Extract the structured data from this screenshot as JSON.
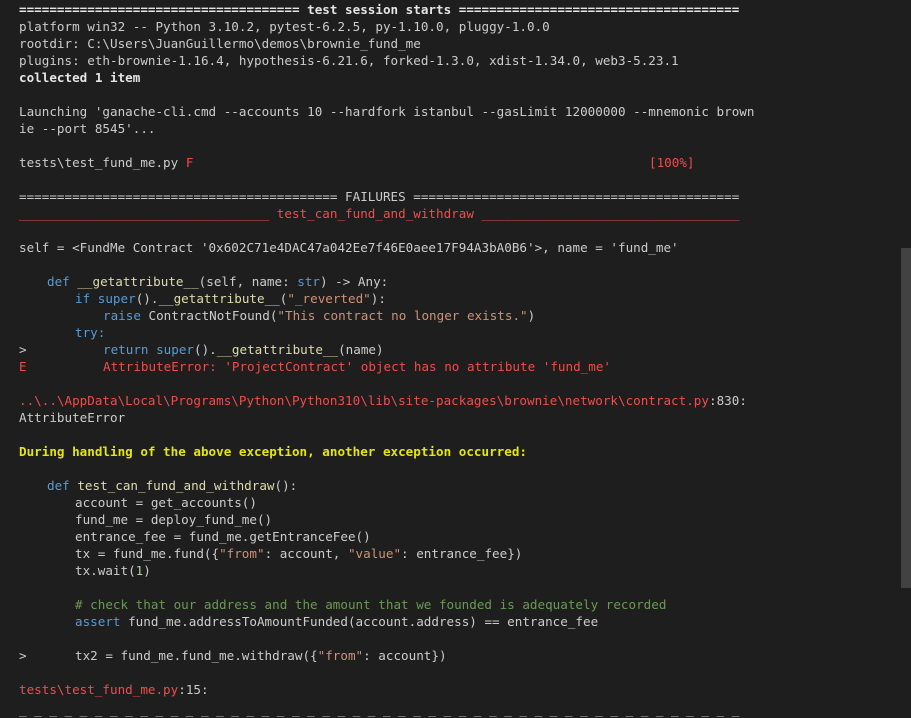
{
  "terminal": {
    "lines": {
      "session_header": "===================================== test session starts =====================================",
      "platform": "platform win32 -- Python 3.10.2, pytest-6.2.5, py-1.10.0, pluggy-1.0.0",
      "rootdir": "rootdir: C:\\Users\\JuanGuillermo\\demos\\brownie_fund_me",
      "plugins": "plugins: eth-brownie-1.16.4, hypothesis-6.21.6, forked-1.3.0, xdist-1.34.0, web3-5.23.1",
      "collected": "collected 1 item",
      "launching_1": "Launching 'ganache-cli.cmd --accounts 10 --hardfork istanbul --gasLimit 12000000 --mnemonic brown",
      "launching_2": "ie --port 8545'...",
      "test_file": "tests\\test_fund_me.py ",
      "test_result": "F",
      "progress": "[100%]",
      "failures_header": "========================================== FAILURES ===========================================",
      "test_name_header": "_________________________________ test_can_fund_and_withdraw __________________________________",
      "self_line": "self = <FundMe Contract '0x602C71e4DAC47a042Ee7f46E0aee17F94A3bA0B6'>, name = 'fund_me'",
      "traceback_path": "..\\..\\AppData\\Local\\Programs\\Python\\Python310\\lib\\site-packages\\brownie\\network\\contract.py",
      "traceback_lineno": ":830:",
      "attribute_error": "AttributeError",
      "during_handling": "During handling of the above exception, another exception occurred:",
      "final_path": "tests\\test_fund_me.py",
      "final_lineno": ":15:",
      "bottom_separator": "_ _ _ _ _ _ _ _ _ _ _ _ _ _ _ _ _ _ _ _ _ _ _ _ _ _ _ _ _ _ _ _ _ _ _ _ _ _ _ _ _ _ _ _ _ _ _ _"
    },
    "code1": {
      "def_kw": "def",
      "def_name": "__getattribute__",
      "def_sig_a": "(self, name: ",
      "def_type": "str",
      "def_sig_b": ") -> Any:",
      "if_kw": "if",
      "super_fn": "super",
      "if_mid": "().",
      "getattr_fn": "__getattribute__",
      "if_open": "(",
      "reverted_str": "\"_reverted\"",
      "if_close": "):",
      "raise_kw": "raise",
      "raise_mid": " ContractNotFound(",
      "raise_str": "\"This contract no longer exists.\"",
      "raise_close": ")",
      "try_kw": "try:",
      "marker_gt": ">",
      "return_kw": "return",
      "return_super": "super",
      "return_mid": "().",
      "return_fn": "__getattribute__",
      "return_tail": "(name)",
      "marker_e": "E",
      "error_msg": "AttributeError: 'ProjectContract' object has no attribute 'fund_me'"
    },
    "code2": {
      "def_kw": "def",
      "def_name": "test_can_fund_and_withdraw",
      "def_tail": "():",
      "account": "account = get_accounts()",
      "fund_me": "fund_me = deploy_fund_me()",
      "entrance_fee": "entrance_fee = fund_me.getEntranceFee()",
      "tx_a": "tx = fund_me.fund({",
      "tx_from": "\"from\"",
      "tx_b": ": account, ",
      "tx_value": "\"value\"",
      "tx_c": ": entrance_fee})",
      "wait_a": "tx.wait(",
      "wait_num": "1",
      "wait_b": ")",
      "comment": "# check that our address and the amount that we founded is adequately recorded",
      "assert_kw": "assert",
      "assert_tail": " fund_me.addressToAmountFunded(account.address) == entrance_fee",
      "marker_gt": ">",
      "tx2_a": "tx2 = fund_me.fund_me.withdraw({",
      "tx2_from": "\"from\"",
      "tx2_b": ": account})"
    }
  }
}
